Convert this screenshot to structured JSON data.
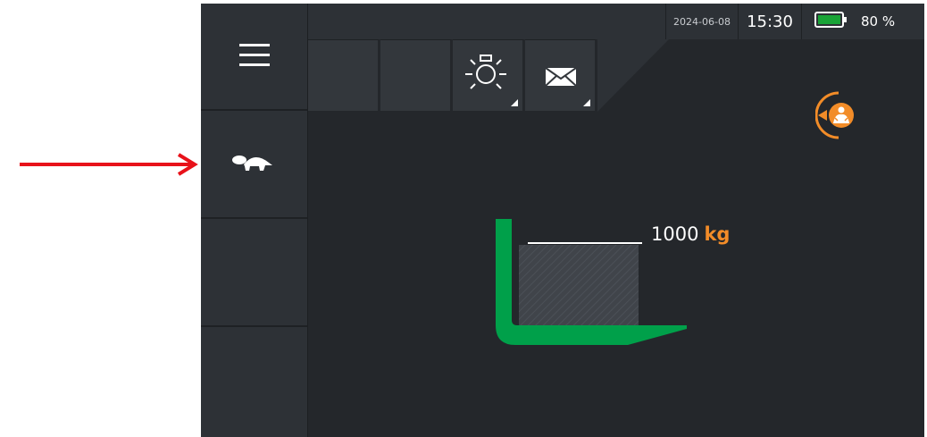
{
  "status": {
    "date": "2024-06-08",
    "time": "15:30",
    "battery_percent": "80 %",
    "battery_level": 0.8
  },
  "sidebar": {
    "items": [
      {
        "name": "menu",
        "icon": "hamburger-menu-icon"
      },
      {
        "name": "slow-mode",
        "icon": "turtle-icon"
      },
      {
        "name": "empty-slot-1",
        "icon": ""
      },
      {
        "name": "empty-slot-2",
        "icon": ""
      }
    ]
  },
  "toolbar": {
    "tiles": [
      {
        "icon": ""
      },
      {
        "icon": ""
      },
      {
        "icon": "work-light-icon"
      },
      {
        "icon": "envelope-icon"
      }
    ]
  },
  "load": {
    "value": "1000",
    "unit": "kg"
  },
  "colors": {
    "background": "#24272b",
    "panel": "#2d3136",
    "accent_orange": "#f28c28",
    "fork_green": "#00a04a",
    "battery_green": "#19a337",
    "annotation_red": "#e8121a"
  }
}
